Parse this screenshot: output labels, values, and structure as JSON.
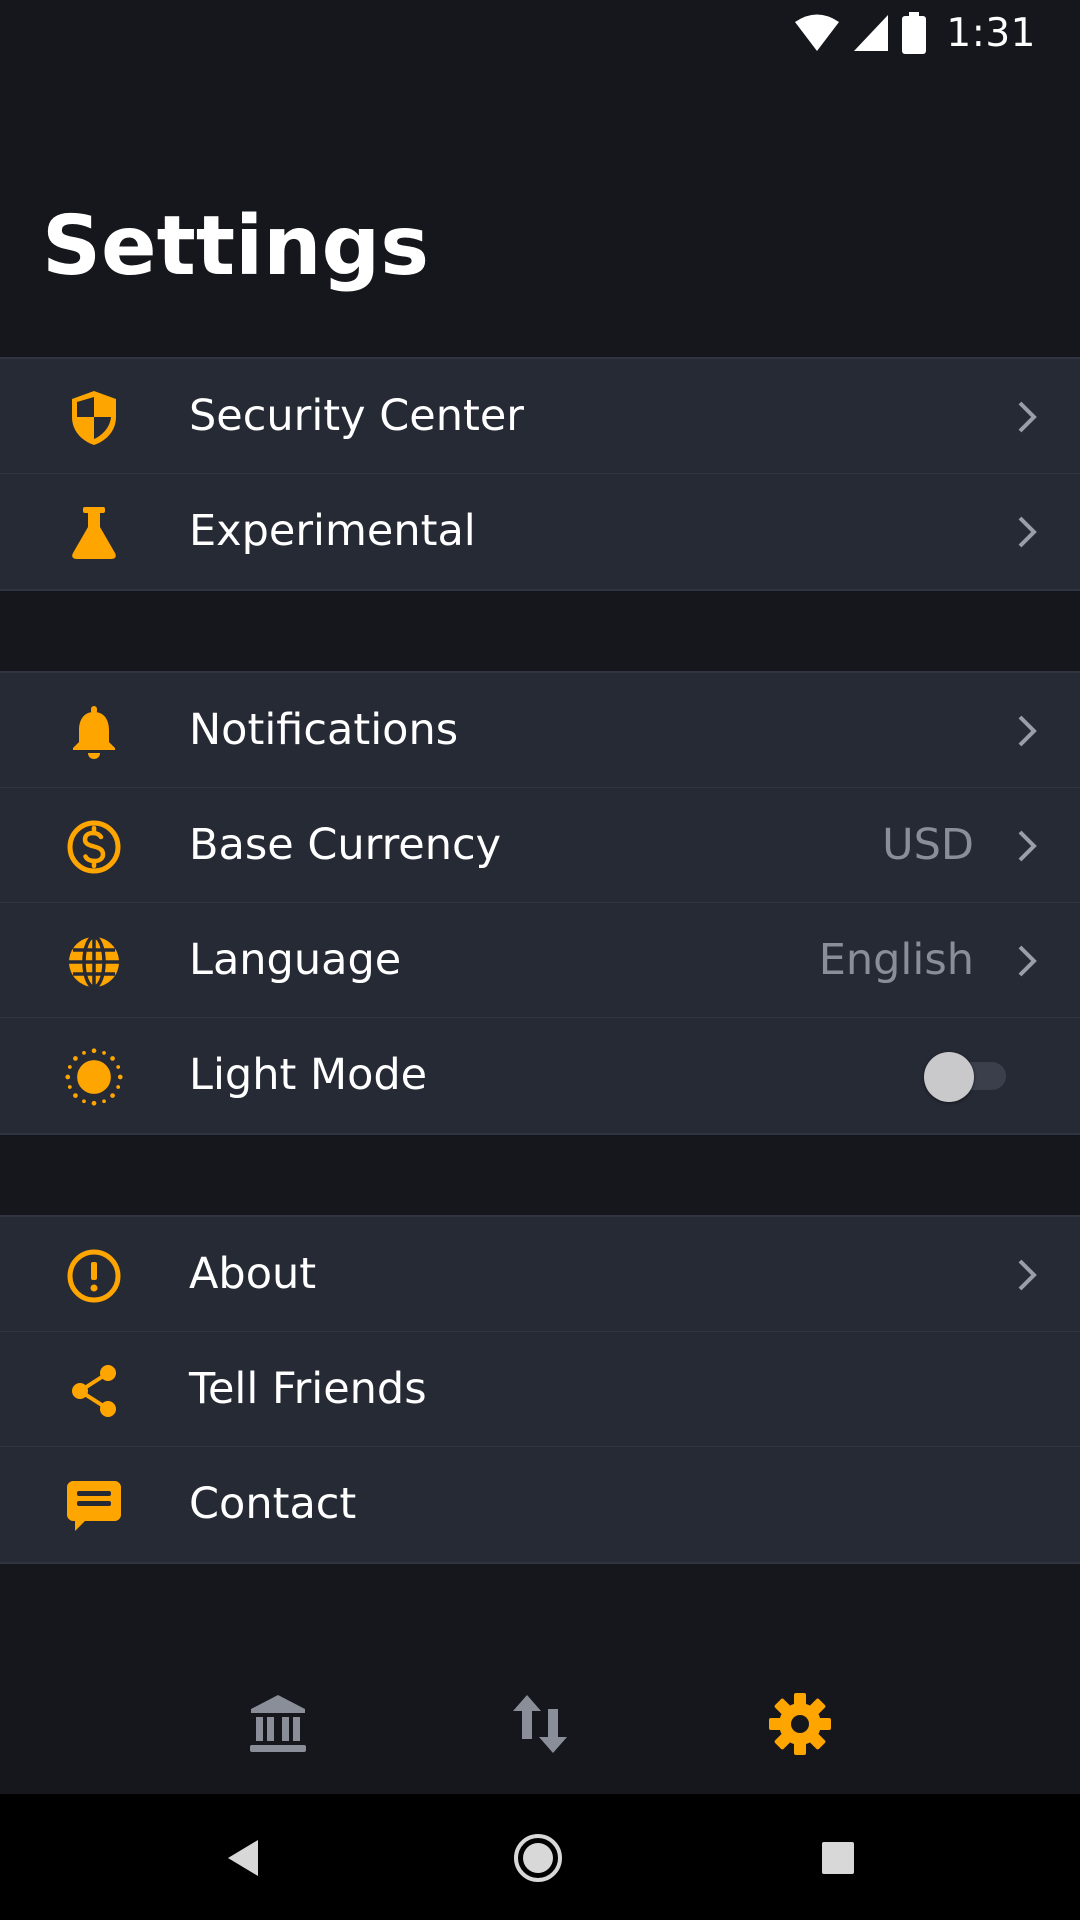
{
  "status_bar": {
    "time": "1:31",
    "icons": [
      "wifi-icon",
      "cell-signal-icon",
      "battery-icon"
    ]
  },
  "title": "Settings",
  "colors": {
    "accent": "#ffa500",
    "background": "#16171c",
    "row_background": "#262a35",
    "muted_text": "#8a8e99"
  },
  "groups": [
    {
      "items": [
        {
          "label": "Security Center",
          "icon": "shield-icon",
          "chevron": true
        },
        {
          "label": "Experimental",
          "icon": "flask-icon",
          "chevron": true
        }
      ]
    },
    {
      "items": [
        {
          "label": "Notifications",
          "icon": "bell-icon",
          "chevron": true
        },
        {
          "label": "Base Currency",
          "value": "USD",
          "icon": "dollar-circle-icon",
          "chevron": true
        },
        {
          "label": "Language",
          "value": "English",
          "icon": "globe-icon",
          "chevron": true
        },
        {
          "label": "Light Mode",
          "icon": "sun-icon",
          "toggle": false
        }
      ]
    },
    {
      "items": [
        {
          "label": "About",
          "icon": "info-circle-icon",
          "chevron": true
        },
        {
          "label": "Tell Friends",
          "icon": "share-icon"
        },
        {
          "label": "Contact",
          "icon": "chat-icon"
        }
      ]
    }
  ],
  "bottom_nav": [
    {
      "icon": "bank-icon",
      "active": false
    },
    {
      "icon": "transfer-arrows-icon",
      "active": false
    },
    {
      "icon": "gear-icon",
      "active": true
    }
  ],
  "system_nav": [
    "back-icon",
    "home-icon",
    "recents-icon"
  ]
}
